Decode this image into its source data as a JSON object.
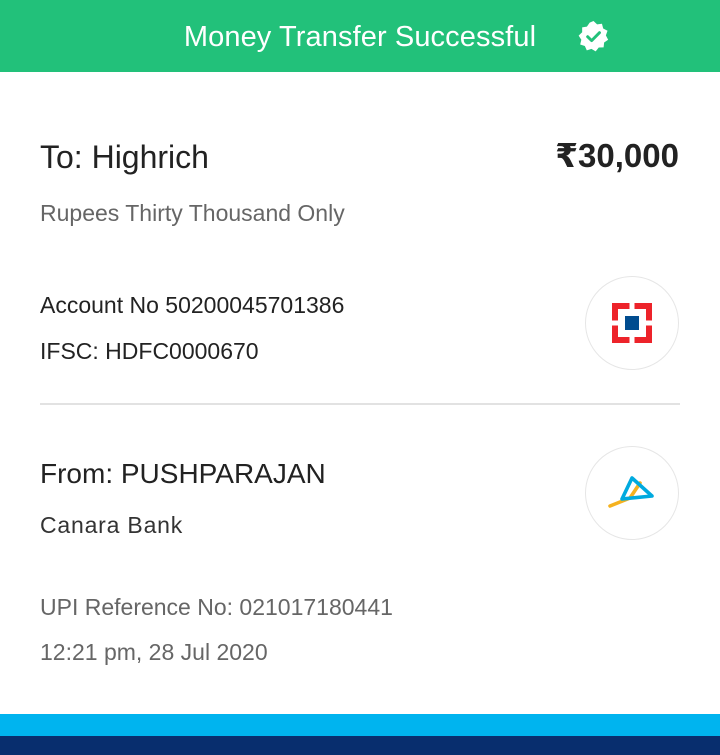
{
  "header": {
    "title": "Money Transfer Successful",
    "icon": "verified-badge-icon",
    "background": "#22c17a"
  },
  "recipient": {
    "to_label": "To: Highrich",
    "amount": "₹30,000",
    "amount_words": "Rupees Thirty Thousand Only",
    "account_no": "Account No 50200045701386",
    "ifsc": "IFSC: HDFC0000670",
    "bank_logo": "hdfc-bank-logo-icon"
  },
  "sender": {
    "from_label": "From: PUSHPARAJAN",
    "bank_name": "Canara Bank",
    "bank_logo": "bank-logo-icon"
  },
  "transaction": {
    "upi_reference": "UPI Reference No: 021017180441",
    "timestamp": "12:21 pm, 28 Jul 2020"
  },
  "colors": {
    "accent_green": "#22c17a",
    "footer_light_blue": "#00b4ef",
    "footer_dark_blue": "#082e6e"
  }
}
